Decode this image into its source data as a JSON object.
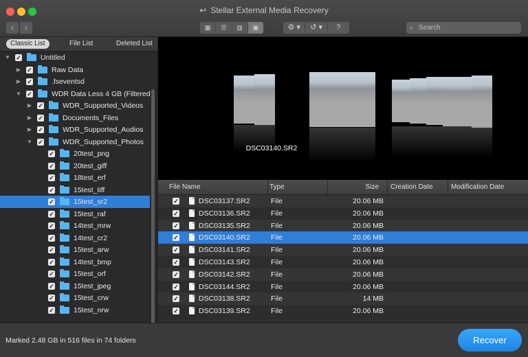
{
  "window": {
    "title": "Stellar External Media Recovery"
  },
  "toolbar": {
    "back_icon": "chevron-left-icon",
    "forward_icon": "chevron-right-icon",
    "view_modes": [
      "icon-grid-view",
      "list-view",
      "column-view",
      "coverflow-view"
    ],
    "active_view": "coverflow-view",
    "tools": [
      "gear-icon",
      "history-icon",
      "help-icon"
    ],
    "help_label": "?",
    "search_placeholder": "Search"
  },
  "tabs": {
    "classic": "Classic List",
    "file": "File List",
    "deleted": "Deleted List",
    "active": "Classic List"
  },
  "tree": [
    {
      "label": "Untitled",
      "depth": 0,
      "expanded": true,
      "checked": true
    },
    {
      "label": "Raw Data",
      "depth": 1,
      "expanded": false,
      "checked": true
    },
    {
      "label": ".fseventsd",
      "depth": 1,
      "expanded": false,
      "checked": true
    },
    {
      "label": "WDR Data Less 4 GB (Filtered",
      "depth": 1,
      "expanded": true,
      "checked": true
    },
    {
      "label": "WDR_Supported_Videos",
      "depth": 2,
      "expanded": false,
      "checked": true
    },
    {
      "label": "Documents_Files",
      "depth": 2,
      "expanded": false,
      "checked": true
    },
    {
      "label": "WDR_Supported_Audios",
      "depth": 2,
      "expanded": false,
      "checked": true
    },
    {
      "label": "WDR_Supported_Photos",
      "depth": 2,
      "expanded": true,
      "checked": true
    },
    {
      "label": "20test_png",
      "depth": 3,
      "checked": true
    },
    {
      "label": "20test_giff",
      "depth": 3,
      "checked": true
    },
    {
      "label": "18test_erf",
      "depth": 3,
      "checked": true
    },
    {
      "label": "15test_tiff",
      "depth": 3,
      "checked": true
    },
    {
      "label": "15test_sr2",
      "depth": 3,
      "checked": true,
      "selected": true
    },
    {
      "label": "15test_raf",
      "depth": 3,
      "checked": true
    },
    {
      "label": "14test_mrw",
      "depth": 3,
      "checked": true
    },
    {
      "label": "14test_cr2",
      "depth": 3,
      "checked": true
    },
    {
      "label": "15test_arw",
      "depth": 3,
      "checked": true
    },
    {
      "label": "14test_bmp",
      "depth": 3,
      "checked": true
    },
    {
      "label": "15test_orf",
      "depth": 3,
      "checked": true
    },
    {
      "label": "15test_jpeg",
      "depth": 3,
      "checked": true
    },
    {
      "label": "15test_crw",
      "depth": 3,
      "checked": true
    },
    {
      "label": "15test_nrw",
      "depth": 3,
      "checked": true
    }
  ],
  "preview": {
    "caption": "DSC03140.SR2"
  },
  "table": {
    "columns": [
      "File Name",
      "Type",
      "Size",
      "Creation Date",
      "Modification Date"
    ],
    "rows": [
      {
        "name": "DSC03137.SR2",
        "type": "File",
        "size": "20.06 MB",
        "checked": true
      },
      {
        "name": "DSC03136.SR2",
        "type": "File",
        "size": "20.06 MB",
        "checked": true
      },
      {
        "name": "DSC03135.SR2",
        "type": "File",
        "size": "20.06 MB",
        "checked": true
      },
      {
        "name": "DSC03140.SR2",
        "type": "File",
        "size": "20.06 MB",
        "checked": true,
        "selected": true
      },
      {
        "name": "DSC03141.SR2",
        "type": "File",
        "size": "20.06 MB",
        "checked": true
      },
      {
        "name": "DSC03143.SR2",
        "type": "File",
        "size": "20.06 MB",
        "checked": true
      },
      {
        "name": "DSC03142.SR2",
        "type": "File",
        "size": "20.06 MB",
        "checked": true
      },
      {
        "name": "DSC03144.SR2",
        "type": "File",
        "size": "20.06 MB",
        "checked": true
      },
      {
        "name": "DSC03138.SR2",
        "type": "File",
        "size": "14  MB",
        "checked": true
      },
      {
        "name": "DSC03139.SR2",
        "type": "File",
        "size": "20.06 MB",
        "checked": true
      }
    ]
  },
  "status": {
    "text": "Marked 2.48 GB in 516 files in 74 folders"
  },
  "actions": {
    "recover_label": "Recover"
  },
  "colors": {
    "accent": "#2f7ed8",
    "folder": "#55b6ef",
    "recover": "#2a97f0"
  }
}
